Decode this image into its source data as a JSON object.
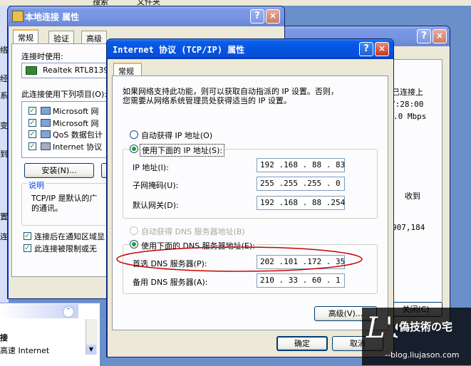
{
  "bg_top": {
    "left_items": [
      "搜索",
      "文件夹"
    ]
  },
  "props_window": {
    "title": "本地连接 属性",
    "tabs": [
      "常规",
      "验证",
      "高级"
    ],
    "connect_using_label": "连接时使用:",
    "adapter": "Realtek RTL8139",
    "items_label": "此连接使用下列项目(O):",
    "items": [
      {
        "label": "Microsoft 网",
        "checked": true
      },
      {
        "label": "Microsoft 网",
        "checked": true
      },
      {
        "label": "QoS 数据包计",
        "checked": true
      },
      {
        "label": "Internet 协议",
        "checked": true
      }
    ],
    "install_button": "安装(N)...",
    "description_title": "说明",
    "description_line1": "TCP/IP 是默认的广",
    "description_line2": "的通讯。",
    "notify_check": "连接后在通知区域显",
    "notify_check2": "此连接被限制或无",
    "help_button": "?",
    "close_button": "×"
  },
  "status_window": {
    "status_texts": [
      "已连接上",
      "7:28:00",
      ".0 Mbps"
    ],
    "received_label": "收到",
    "received_value": "907,184",
    "close_label": "关闭(C)",
    "help_button": "?",
    "close_button": "×"
  },
  "left_panel": {
    "side_letters": [
      "络",
      "经",
      "系",
      "变",
      "到",
      "连",
      "置"
    ],
    "bottom_items": [
      "接",
      "高速 Internet"
    ]
  },
  "tcpip_dialog": {
    "title": "Internet 协议 (TCP/IP) 属性",
    "help_button": "?",
    "close_button": "×",
    "tab": "常规",
    "intro_line1": "如果网络支持此功能，则可以获取自动指派的 IP 设置。否则，",
    "intro_line2": "您需要从网络系统管理员处获得适当的 IP 设置。",
    "auto_ip_label": "自动获得 IP 地址(O)",
    "manual_ip_label": "使用下面的 IP 地址(S):",
    "ip_label": "IP 地址(I):",
    "ip_value": "192 .168 . 88 . 83",
    "mask_label": "子网掩码(U):",
    "mask_value": "255 .255 .255 . 0",
    "gateway_label": "默认网关(D):",
    "gateway_value": "192 .168 . 88 .254",
    "auto_dns_label": "自动获得 DNS 服务器地址(B)",
    "manual_dns_label": "使用下面的 DNS 服务器地址(E):",
    "dns1_label": "首选 DNS 服务器(P):",
    "dns1_value": "202 .101 .172 . 35",
    "dns2_label": "备用 DNS 服务器(A):",
    "dns2_value": "210 . 33 . 60 . 1",
    "advanced_button": "高级(V)...",
    "ok_button": "确定",
    "cancel_button": "取消"
  },
  "watermark": {
    "brand": "偽技術の宅",
    "url": "--blog.liujason.com",
    "logo": "L's"
  },
  "colors": {
    "titlebar_active": "#0454e1",
    "dialog_bg": "#ece9d8",
    "highlight_ellipse": "#cc0000"
  }
}
